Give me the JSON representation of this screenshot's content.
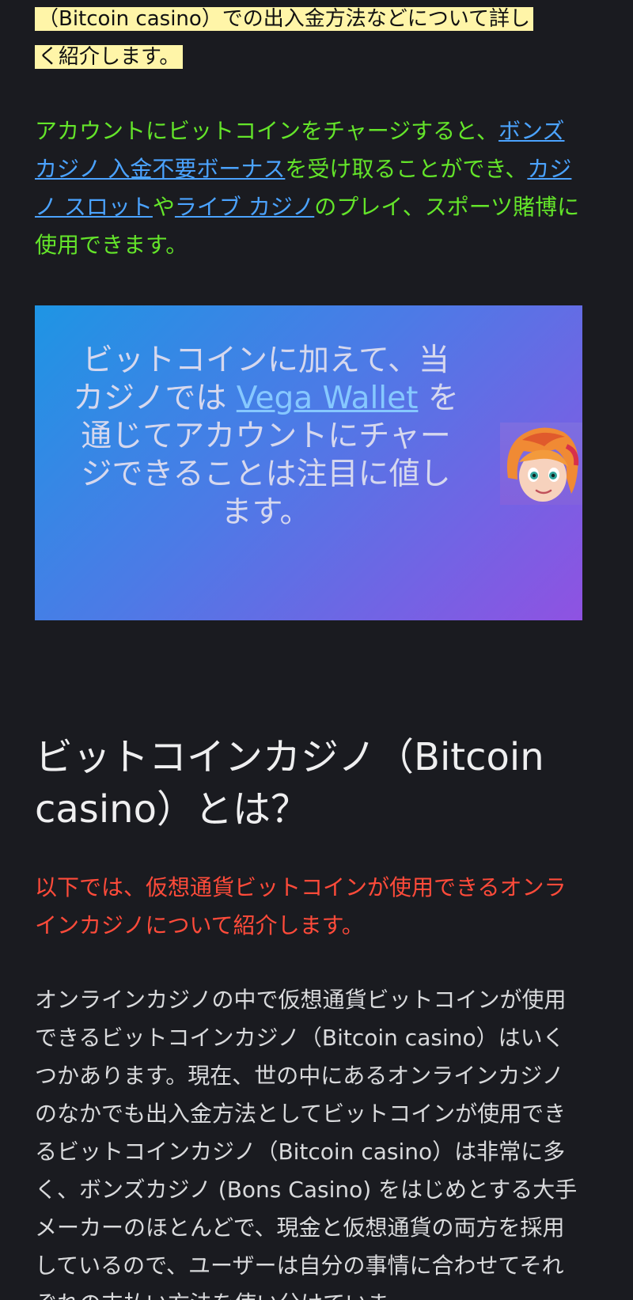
{
  "intro": {
    "line1": "（Bitcoin casino）での出入金方法などについて詳し",
    "line2": "く紹介します。"
  },
  "green_paragraph": {
    "text1": "アカウントにビットコインをチャージすると、",
    "link1": "ボンズカジノ 入金不要ボーナス",
    "text2": "を受け取ることができ、",
    "link2": "カジノ スロット",
    "text3": "や",
    "link3": "ライブ カジノ",
    "text4": "のプレイ、スポーツ賭博に使用できます。"
  },
  "banner": {
    "text1": "ビットコインに加えて、当カジノでは ",
    "link": "Vega Wallet",
    "text2": " を通じてアカウントにチャージできることは注目に値します。"
  },
  "section": {
    "heading": "ビットコインカジノ（Bitcoin casino）とは？",
    "lead": "以下では、仮想通貨ビットコインが使用できるオンラインカジノについて紹介します。",
    "body": "オンラインカジノの中で仮想通貨ビットコインが使用できるビットコインカジノ（Bitcoin casino）はいくつかあります。現在、世の中にあるオンラインカジノのなかでも出入金方法としてビットコインが使用できるビットコインカジノ（Bitcoin casino）は非常に多く、ボンズカジノ (Bons Casino) をはじめとする大手メーカーのほとんどで、現金と仮想通貨の両方を採用しているので、ユーザーは自分の事情に合わせてそれぞれの支払い方法を使い分けていま"
  },
  "colors": {
    "background": "#1a1b20",
    "highlight": "#fff5a8",
    "green_text": "#64e52a",
    "link": "#4ba3ff",
    "red_text": "#ff4b3a"
  },
  "icons": {
    "banner_avatar": "cartoon-girl-avatar"
  }
}
